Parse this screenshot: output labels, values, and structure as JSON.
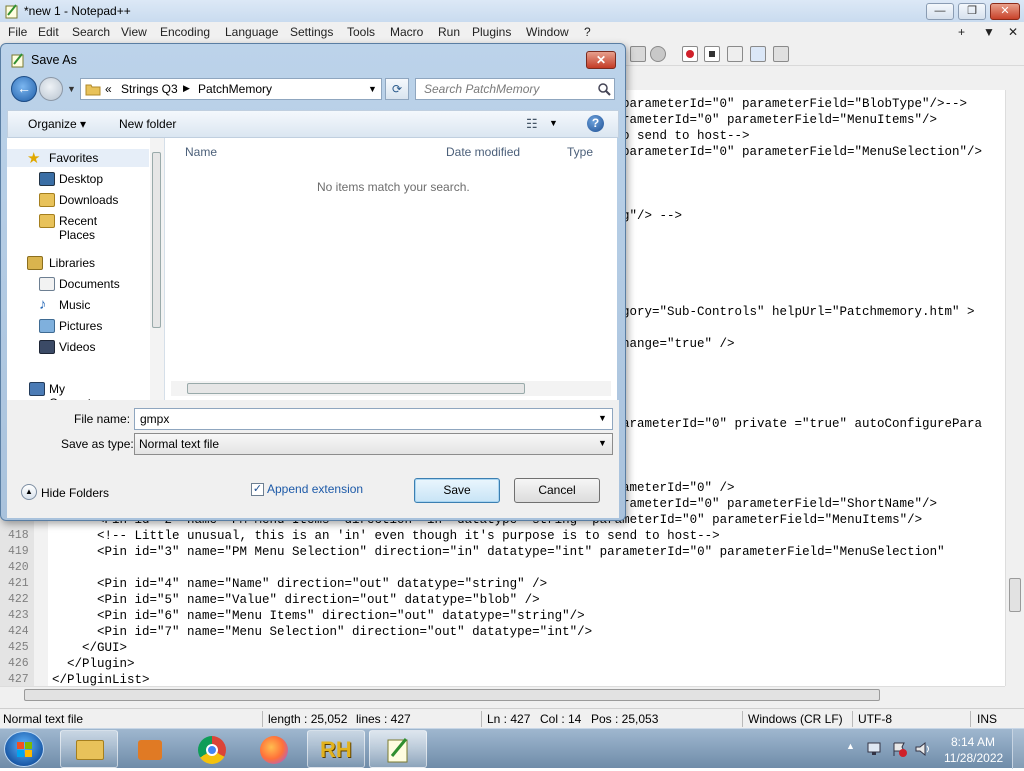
{
  "npp": {
    "title": "*new 1 - Notepad++",
    "menu": [
      "File",
      "Edit",
      "Search",
      "View",
      "Encoding",
      "Language",
      "Settings",
      "Tools",
      "Macro",
      "Run",
      "Plugins",
      "Window",
      "?"
    ],
    "menu_right": [
      "+",
      "▼",
      "✕"
    ],
    "window_buttons": [
      "—",
      "❐",
      "✕"
    ]
  },
  "editor": {
    "right_fragments": [
      "parameterId=\"0\" parameterField=\"BlobType\"/>-->",
      "rameterId=\"0\" parameterField=\"MenuItems\"/>",
      "o send to host-->",
      "parameterId=\"0\" parameterField=\"MenuSelection\"/>",
      "g\"/> -->",
      "gory=\"Sub-Controls\" helpUrl=\"Patchmemory.htm\" >",
      "hange=\"true\" />",
      "arameterId=\"0\" private =\"true\" autoConfigurePara",
      "ameterId=\"0\" />",
      "rameterId=\"0\" parameterField=\"ShortName\"/>"
    ],
    "lines": [
      {
        "num": "",
        "text": "      <Pin id=\"2\" name=\"PM Menu Items\" direction=\"in\" datatype=\"string\" parameterId=\"0\" parameterField=\"MenuItems\"/>"
      },
      {
        "num": "418",
        "text": "      <!-- Little unusual, this is an 'in' even though it's purpose is to send to host-->"
      },
      {
        "num": "419",
        "text": "      <Pin id=\"3\" name=\"PM Menu Selection\" direction=\"in\" datatype=\"int\" parameterId=\"0\" parameterField=\"MenuSelection\""
      },
      {
        "num": "420",
        "text": ""
      },
      {
        "num": "421",
        "text": "      <Pin id=\"4\" name=\"Name\" direction=\"out\" datatype=\"string\" />"
      },
      {
        "num": "422",
        "text": "      <Pin id=\"5\" name=\"Value\" direction=\"out\" datatype=\"blob\" />"
      },
      {
        "num": "423",
        "text": "      <Pin id=\"6\" name=\"Menu Items\" direction=\"out\" datatype=\"string\"/>"
      },
      {
        "num": "424",
        "text": "      <Pin id=\"7\" name=\"Menu Selection\" direction=\"out\" datatype=\"int\"/>"
      },
      {
        "num": "425",
        "text": "    </GUI>"
      },
      {
        "num": "426",
        "text": "  </Plugin>"
      },
      {
        "num": "427",
        "text": "</PluginList>"
      }
    ]
  },
  "status": {
    "type": "Normal text file",
    "length": "length : 25,052",
    "lines": "lines : 427",
    "ln": "Ln : 427",
    "col": "Col : 14",
    "pos": "Pos : 25,053",
    "eol": "Windows (CR LF)",
    "encoding": "UTF-8",
    "mode": "INS"
  },
  "dialog": {
    "title": "Save As",
    "breadcrumb": [
      "«",
      "Strings Q3",
      "PatchMemory"
    ],
    "search_placeholder": "Search PatchMemory",
    "organize": "Organize",
    "new_folder": "New folder",
    "nav": {
      "favorites": "Favorites",
      "desktop": "Desktop",
      "downloads": "Downloads",
      "recent": "Recent Places",
      "libraries": "Libraries",
      "documents": "Documents",
      "music": "Music",
      "pictures": "Pictures",
      "videos": "Videos",
      "computer": "My Computer"
    },
    "columns": [
      "Name",
      "Date modified",
      "Type"
    ],
    "empty_message": "No items match your search.",
    "file_name_label": "File name:",
    "file_name_value": "gmpx",
    "save_type_label": "Save as type:",
    "save_type_value": "Normal text file",
    "hide_folders": "Hide Folders",
    "append_extension": "Append extension",
    "append_checked": true,
    "save": "Save",
    "cancel": "Cancel"
  },
  "taskbar": {
    "time": "8:14 AM",
    "date": "11/28/2022",
    "apps": [
      "explorer",
      "media-player",
      "chrome",
      "firefox",
      "rh",
      "notepad-plus-plus"
    ]
  }
}
